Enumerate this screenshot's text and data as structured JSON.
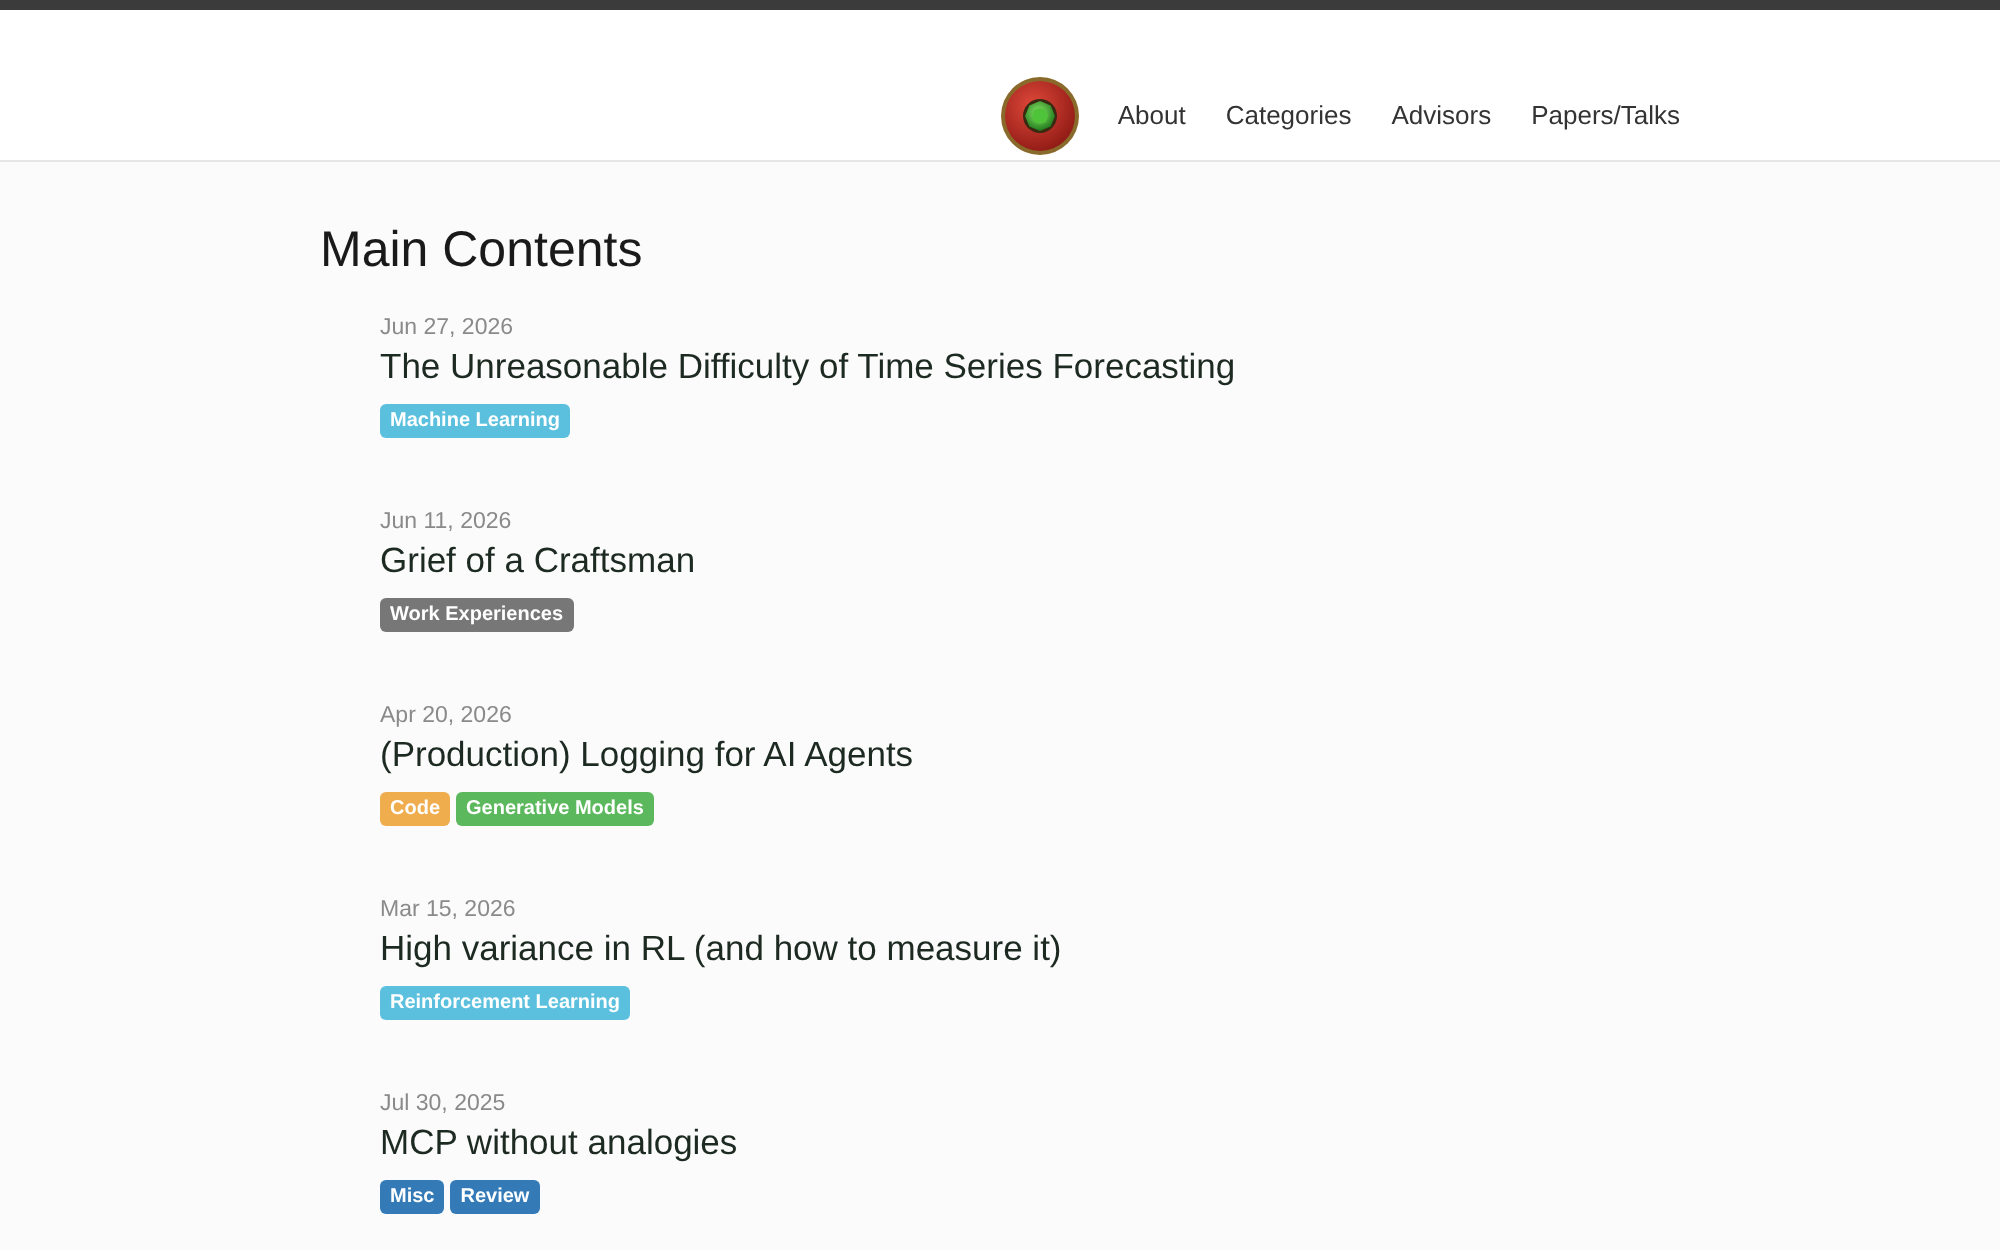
{
  "header": {
    "nav": [
      {
        "label": "About"
      },
      {
        "label": "Categories"
      },
      {
        "label": "Advisors"
      },
      {
        "label": "Papers/Talks"
      }
    ]
  },
  "main": {
    "heading": "Main Contents",
    "posts": [
      {
        "date": "Jun 27, 2026",
        "title": "The Unreasonable Difficulty of Time Series Forecasting",
        "tags": [
          {
            "label": "Machine Learning",
            "color": "#5bc0de"
          }
        ]
      },
      {
        "date": "Jun 11, 2026",
        "title": "Grief of a Craftsman",
        "tags": [
          {
            "label": "Work Experiences",
            "color": "#777777"
          }
        ]
      },
      {
        "date": "Apr 20, 2026",
        "title": "(Production) Logging for AI Agents",
        "tags": [
          {
            "label": "Code",
            "color": "#f0ad4e"
          },
          {
            "label": "Generative Models",
            "color": "#5cb85c"
          }
        ]
      },
      {
        "date": "Mar 15, 2026",
        "title": "High variance in RL (and how to measure it)",
        "tags": [
          {
            "label": "Reinforcement Learning",
            "color": "#5bc0de"
          }
        ]
      },
      {
        "date": "Jul 30, 2025",
        "title": "MCP without analogies",
        "tags": [
          {
            "label": "Misc",
            "color": "#337ab7"
          },
          {
            "label": "Review",
            "color": "#337ab7"
          }
        ]
      }
    ]
  }
}
